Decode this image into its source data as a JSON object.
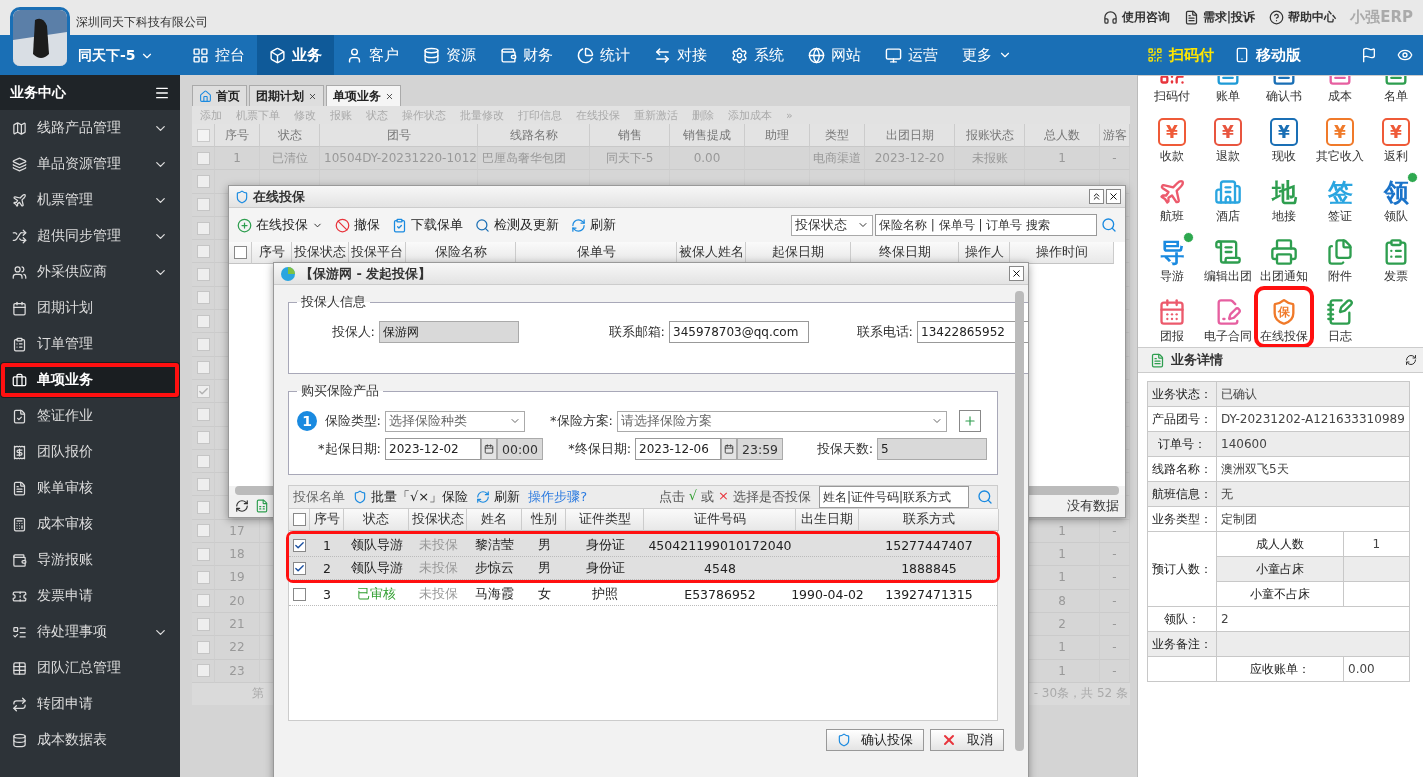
{
  "company": "深圳同天下科技有限公司",
  "top_links": [
    "使用咨询",
    "需求|投诉",
    "帮助中心"
  ],
  "brand": "小强ERP",
  "user": "同天下-5",
  "nav": [
    {
      "label": "控台",
      "selected": false
    },
    {
      "label": "业务",
      "selected": true
    },
    {
      "label": "客户",
      "selected": false
    },
    {
      "label": "资源",
      "selected": false
    },
    {
      "label": "财务",
      "selected": false
    },
    {
      "label": "统计",
      "selected": false
    },
    {
      "label": "对接",
      "selected": false
    },
    {
      "label": "系统",
      "selected": false
    },
    {
      "label": "网站",
      "selected": false
    },
    {
      "label": "运营",
      "selected": false
    }
  ],
  "nav_more": "更多",
  "nav_right": [
    "扫码付",
    "移动版"
  ],
  "sidebar": {
    "title": "业务中心",
    "items": [
      {
        "label": "线路产品管理",
        "expandable": true,
        "selected": false
      },
      {
        "label": "单品资源管理",
        "expandable": true,
        "selected": false
      },
      {
        "label": "机票管理",
        "expandable": true,
        "selected": false
      },
      {
        "label": "超供同步管理",
        "expandable": true,
        "selected": false
      },
      {
        "label": "外采供应商",
        "expandable": true,
        "selected": false
      },
      {
        "label": "团期计划",
        "expandable": false,
        "selected": false
      },
      {
        "label": "订单管理",
        "expandable": false,
        "selected": false
      },
      {
        "label": "单项业务",
        "expandable": false,
        "selected": true,
        "highlighted": true
      },
      {
        "label": "签证作业",
        "expandable": false,
        "selected": false
      },
      {
        "label": "团队报价",
        "expandable": false,
        "selected": false
      },
      {
        "label": "账单审核",
        "expandable": false,
        "selected": false
      },
      {
        "label": "成本审核",
        "expandable": false,
        "selected": false
      },
      {
        "label": "导游报账",
        "expandable": false,
        "selected": false
      },
      {
        "label": "发票申请",
        "expandable": false,
        "selected": false
      },
      {
        "label": "待处理事项",
        "expandable": true,
        "selected": false
      },
      {
        "label": "团队汇总管理",
        "expandable": false,
        "selected": false
      },
      {
        "label": "转团申请",
        "expandable": false,
        "selected": false
      },
      {
        "label": "成本数据表",
        "expandable": false,
        "selected": false
      }
    ]
  },
  "tabs": [
    {
      "label": "首页",
      "closable": false,
      "selected": false
    },
    {
      "label": "团期计划",
      "closable": true,
      "selected": false
    },
    {
      "label": "单项业务",
      "closable": true,
      "selected": true
    }
  ],
  "toolbar": [
    "添加",
    "机票下单",
    "修改",
    "报账",
    "状态",
    "操作状态",
    "批量修改",
    "打印信息",
    "在线投保",
    "重新激活",
    "删除",
    "添加成本",
    "»"
  ],
  "table": {
    "all_checked": false,
    "columns": [
      "序号",
      "状态",
      "团号",
      "线路名称",
      "销售",
      "销售提成",
      "助理",
      "类型",
      "出团日期",
      "报账状态",
      "总人数",
      "游客"
    ],
    "rows": [
      {
        "checked": false,
        "index": "1",
        "status": "已清位",
        "group_no": "10504DY-20231220-1012",
        "route": "巴厘岛奢华包团",
        "sales": "同天下-5",
        "commission": "0.00",
        "type": "电商渠道",
        "date": "2023-12-20",
        "settle": "未报账",
        "total": "1",
        "tourist": "-"
      },
      {
        "checked": false
      },
      {
        "checked": false
      },
      {
        "checked": false
      },
      {
        "checked": false
      },
      {
        "checked": false
      },
      {
        "checked": false
      },
      {
        "checked": false
      },
      {
        "checked": false
      },
      {
        "checked": false
      },
      {
        "checked": true
      },
      {
        "checked": false
      },
      {
        "checked": false
      },
      {
        "checked": false
      },
      {
        "checked": false
      },
      {
        "checked": false
      },
      {
        "checked": false,
        "index": "17",
        "total": "1",
        "tourist": "-"
      },
      {
        "checked": false,
        "index": "18",
        "total": "1",
        "tourist": "-"
      },
      {
        "checked": false,
        "index": "19",
        "total": "1",
        "tourist": "-"
      },
      {
        "checked": false,
        "index": "20",
        "total": "8",
        "tourist": "-"
      },
      {
        "checked": false,
        "index": "21",
        "total": "2",
        "tourist": "-"
      },
      {
        "checked": false,
        "index": "22",
        "total": "1",
        "tourist": "-"
      },
      {
        "checked": false,
        "index": "23",
        "total": "1",
        "tourist": "-"
      }
    ]
  },
  "pagination": {
    "page_label": "第",
    "summary": "- 30条，共 52 条"
  },
  "quick_icons": [
    {
      "label": "扫码付",
      "kind": "qr",
      "color": "#e8343c"
    },
    {
      "label": "账单",
      "kind": "doc",
      "color": "#1e9ad6"
    },
    {
      "label": "确认书",
      "kind": "doc",
      "color": "#1a6fb5"
    },
    {
      "label": "成本",
      "kind": "doc",
      "color": "#e65fa0"
    },
    {
      "label": "名单",
      "kind": "doc",
      "color": "#2e9e4f"
    },
    {
      "label": "收款",
      "kind": "glyph",
      "glyph": "¥",
      "color": "#ef5a38",
      "badge": false,
      "highlighted": false
    },
    {
      "label": "退款",
      "kind": "glyph",
      "glyph": "¥",
      "color": "#e8553f",
      "badge": false,
      "highlighted": false
    },
    {
      "label": "现收",
      "kind": "glyph",
      "glyph": "¥",
      "color": "#1a6fb5",
      "badge": false,
      "highlighted": false
    },
    {
      "label": "其它收入",
      "kind": "glyph",
      "glyph": "¥",
      "color": "#f07a2a",
      "badge": false,
      "highlighted": false
    },
    {
      "label": "返利",
      "kind": "glyph",
      "glyph": "¥",
      "color": "#ef5a38",
      "badge": false,
      "highlighted": false
    },
    {
      "label": "航班",
      "kind": "plane",
      "color": "#ec5a6c",
      "badge": false,
      "highlighted": false
    },
    {
      "label": "酒店",
      "kind": "building",
      "color": "#2aa5e0",
      "badge": false,
      "highlighted": false
    },
    {
      "label": "地接",
      "kind": "glyph",
      "glyph": "地",
      "color": "#2e9e4f",
      "badge": false,
      "highlighted": false
    },
    {
      "label": "签证",
      "kind": "glyph",
      "glyph": "签",
      "color": "#2aa5e0",
      "badge": false,
      "highlighted": false
    },
    {
      "label": "领队",
      "kind": "glyph",
      "glyph": "领",
      "color": "#1a73c9",
      "badge": true,
      "highlighted": false
    },
    {
      "label": "导游",
      "kind": "glyph",
      "glyph": "导",
      "color": "#1a8ae0",
      "badge": true,
      "highlighted": false
    },
    {
      "label": "编辑出团",
      "kind": "scroll",
      "color": "#2e9e4f",
      "badge": false,
      "highlighted": false
    },
    {
      "label": "出团通知",
      "kind": "printer",
      "color": "#2e9e4f",
      "badge": false,
      "highlighted": false
    },
    {
      "label": "附件",
      "kind": "files",
      "color": "#2e9e4f",
      "badge": false,
      "highlighted": false
    },
    {
      "label": "发票",
      "kind": "clipboard",
      "color": "#2e9e4f",
      "badge": false,
      "highlighted": false
    },
    {
      "label": "团报",
      "kind": "calendar",
      "color": "#ec5a6c",
      "badge": false,
      "highlighted": false
    },
    {
      "label": "电子合同",
      "kind": "contract",
      "color": "#e65fa0",
      "badge": false,
      "highlighted": false
    },
    {
      "label": "在线投保",
      "kind": "shield",
      "glyph": "保",
      "color": "#f07a2a",
      "badge": false,
      "highlighted": true
    },
    {
      "label": "日志",
      "kind": "journal",
      "color": "#2e9e4f",
      "badge": false,
      "highlighted": false
    }
  ],
  "details": {
    "title": "业务详情",
    "rows": [
      {
        "label": "业务状态：",
        "value": "已确认"
      },
      {
        "label": "产品团号：",
        "value": "DY-20231202-A121633310989"
      },
      {
        "label": "订单号：",
        "value": "140600"
      },
      {
        "label": "线路名称：",
        "value": "澳洲双飞5天"
      },
      {
        "label": "航班信息：",
        "value": "无"
      },
      {
        "label": "业务类型：",
        "value": "定制团"
      },
      {
        "label": "预订人数：",
        "sub": [
          {
            "label": "成人人数",
            "value": "1"
          },
          {
            "label": "小童占床"
          },
          {
            "label": "小童不占床"
          }
        ]
      },
      {
        "label": "领队：",
        "value": "2"
      },
      {
        "label": "业务备注："
      },
      {
        "sub": [
          {
            "label": "应收账单：",
            "value": "0.00"
          }
        ]
      }
    ]
  },
  "insure_window": {
    "title": "在线投保",
    "all_checked": false,
    "toolbar": [
      "在线投保",
      "撤保",
      "下载保单",
      "检测及更新",
      "刷新"
    ],
    "status_filter": "投保状态",
    "search_placeholder": "保险名称 | 保单号 | 订单号 搜索",
    "columns": [
      "序号",
      "投保状态",
      "投保平台",
      "保险名称",
      "保单号",
      "被保人姓名",
      "起保日期",
      "终保日期",
      "操作人",
      "操作时间"
    ],
    "empty_text": "没有数据"
  },
  "launch_window": {
    "title": "【保游网 - 发起投保】",
    "holder": {
      "legend": "投保人信息",
      "fields": [
        {
          "label": "投保人:",
          "value": "保游网",
          "readonly": true
        },
        {
          "label": "联系邮箱:",
          "value": "345978703@qq.com",
          "readonly": false
        },
        {
          "label": "联系电话:",
          "value": "13422865952",
          "readonly": false
        }
      ]
    },
    "product": {
      "legend": "购买保险产品",
      "step": "1",
      "type_label": "保险类型:",
      "type_value": "选择保险种类",
      "plan_label": "*保险方案:",
      "plan_value": "请选择保险方案",
      "start_label": "*起保日期:",
      "start_date": "2023-12-02",
      "start_time": "00:00",
      "end_label": "*终保日期:",
      "end_date": "2023-12-06",
      "end_time": "23:59",
      "days_label": "投保天数:",
      "days": "5"
    },
    "list": {
      "title": "投保名单",
      "all_checked": false,
      "batch": "批量「√×」保险",
      "refresh": "刷新",
      "help": "操作步骤?",
      "hint": [
        "点击",
        "√",
        "或",
        "×",
        "选择是否投保"
      ],
      "search_placeholder": "姓名|证件号码|联系方式",
      "columns": [
        "序号",
        "状态",
        "投保状态",
        "姓名",
        "性别",
        "证件类型",
        "证件号码",
        "出生日期",
        "联系方式"
      ],
      "rows": [
        {
          "checked": true,
          "highlighted": true,
          "approved": false,
          "no": "1",
          "status": "领队导游",
          "insure_status": "未投保",
          "name": "黎洁莹",
          "gender": "男",
          "id_type": "身份证",
          "id_no": "450421199010172040",
          "phone": "15277447407"
        },
        {
          "checked": true,
          "highlighted": true,
          "approved": false,
          "no": "2",
          "status": "领队导游",
          "insure_status": "未投保",
          "name": "步惊云",
          "gender": "男",
          "id_type": "身份证",
          "id_no": "4548",
          "phone": "1888845"
        },
        {
          "checked": false,
          "highlighted": false,
          "approved": true,
          "no": "3",
          "status": "已审核",
          "insure_status": "未投保",
          "name": "马海霞",
          "gender": "女",
          "id_type": "护照",
          "id_no": "E53786952",
          "birth": "1990-04-02",
          "phone": "13927471315"
        }
      ]
    },
    "buttons": [
      "确认投保",
      "取消"
    ]
  }
}
